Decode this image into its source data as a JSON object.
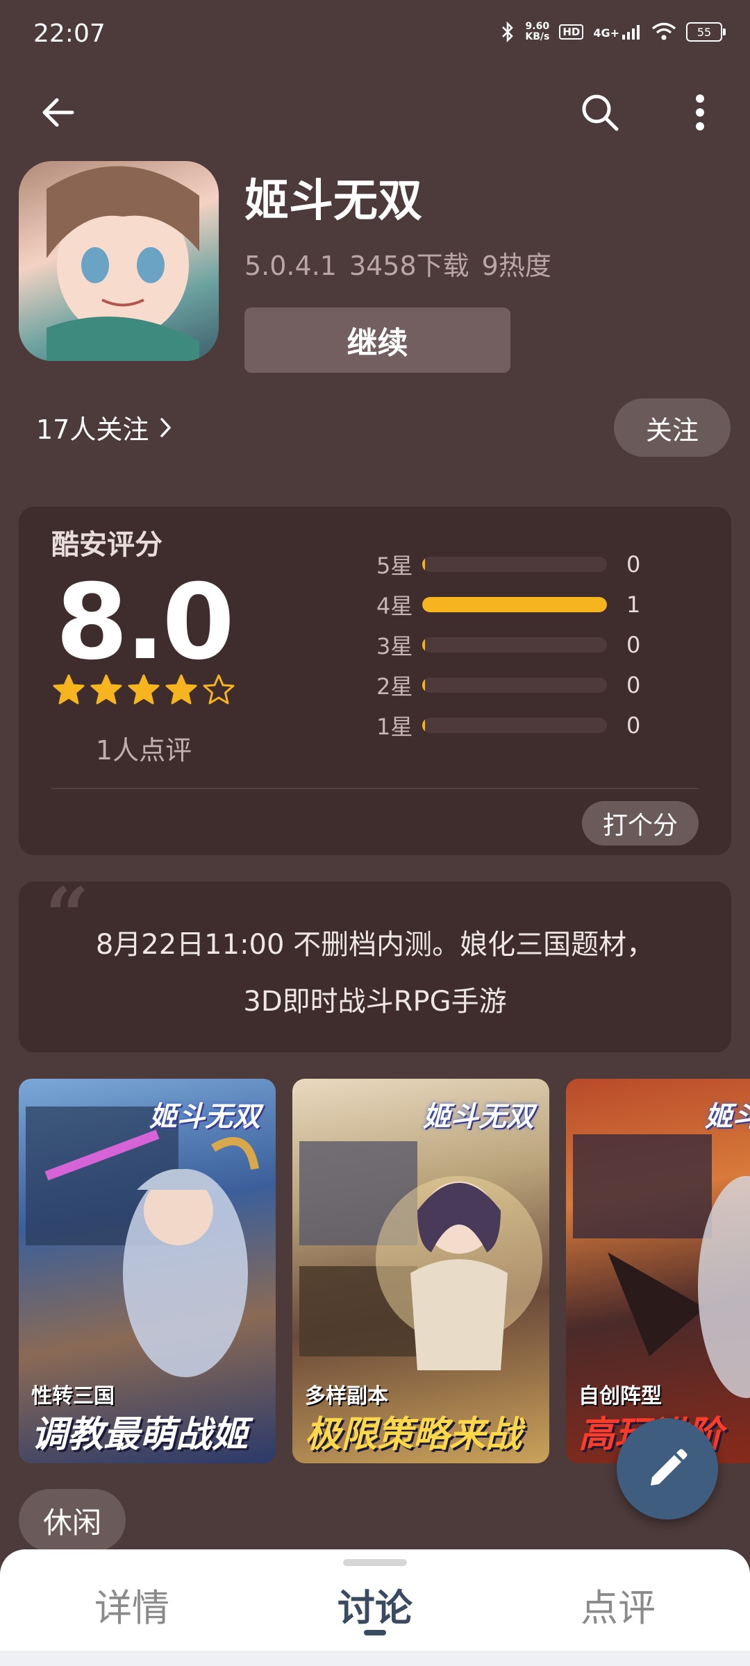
{
  "status_bar": {
    "time": "22:07",
    "net_speed_top": "9.60",
    "net_speed_bottom": "KB/s",
    "hd": "HD",
    "network": "4G+",
    "battery": "55"
  },
  "app": {
    "name": "姬斗无双",
    "version": "5.0.4.1",
    "downloads": "3458下载",
    "heat": "9热度",
    "continue_label": "继续",
    "followers": "17人关注",
    "follow_label": "关注"
  },
  "rating": {
    "title": "酷安评分",
    "score": "8.0",
    "stars_value": 4,
    "stars_max": 5,
    "reviewers": "1人点评",
    "rows": [
      {
        "label": "5星",
        "count": "0",
        "fraction": 0
      },
      {
        "label": "4星",
        "count": "1",
        "fraction": 1
      },
      {
        "label": "3星",
        "count": "0",
        "fraction": 0
      },
      {
        "label": "2星",
        "count": "0",
        "fraction": 0
      },
      {
        "label": "1星",
        "count": "0",
        "fraction": 0
      }
    ],
    "rate_button": "打个分",
    "accent_color": "#f6b41e"
  },
  "description": {
    "line1": "8月22日11:00 不删档内测。娘化三国题材，",
    "line2": "3D即时战斗RPG手游"
  },
  "screenshots": [
    {
      "logo": "姬斗无双",
      "caption_small": "性转三国",
      "caption_big": "调教最萌战姬",
      "caption_color": "#ffffff"
    },
    {
      "logo": "姬斗无双",
      "caption_small": "多样副本",
      "caption_big": "极限策略来战",
      "caption_color": "#ffd84a"
    },
    {
      "logo": "姬斗",
      "caption_small": "自创阵型",
      "caption_big": "高玩进阶",
      "caption_color": "#ff3b2a"
    }
  ],
  "tags": [
    "休闲"
  ],
  "bottom_tabs": {
    "details": "详情",
    "discussion": "讨论",
    "reviews": "点评",
    "active": "discussion"
  }
}
